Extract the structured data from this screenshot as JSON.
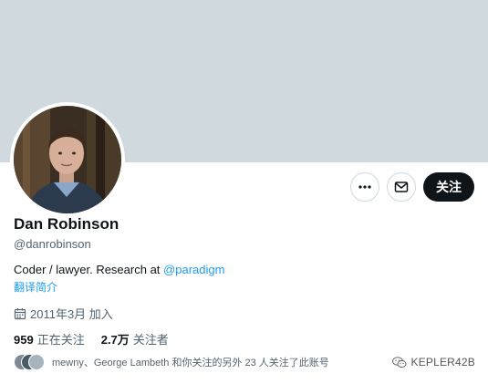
{
  "profile": {
    "name": "Dan Robinson",
    "handle": "@danrobinson",
    "bio_text": "Coder / lawyer. Research at ",
    "bio_link": "@paradigm",
    "translate_label": "翻译简介",
    "joined": "2011年3月 加入",
    "following_count": "959",
    "following_label": "正在关注",
    "followers_count": "2.7万",
    "followers_label": "关注者",
    "mutuals_text": "mewny、George Lambeth 和你关注的另外 23 人关注了此账号"
  },
  "actions": {
    "more_icon": "more-icon",
    "message_icon": "mail-icon",
    "follow_label": "关注"
  },
  "watermark": {
    "text": "KEPLER42B",
    "icon": "wechat-icon"
  },
  "colors": {
    "banner": "#cfd9de",
    "link": "#1d9bf0",
    "follow_button": "#0f1419",
    "secondary_text": "#536471"
  }
}
